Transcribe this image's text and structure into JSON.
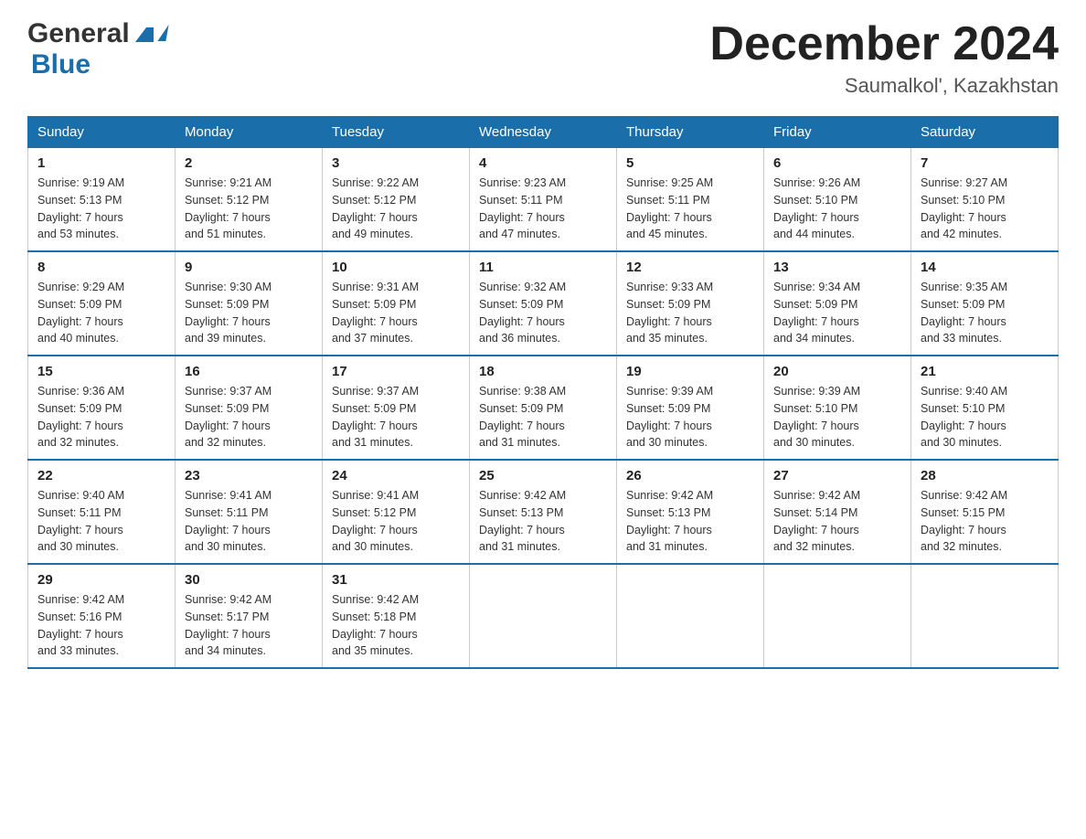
{
  "header": {
    "logo": {
      "text_general": "General",
      "text_blue": "Blue"
    },
    "title": "December 2024",
    "location": "Saumalkol', Kazakhstan"
  },
  "days_of_week": [
    "Sunday",
    "Monday",
    "Tuesday",
    "Wednesday",
    "Thursday",
    "Friday",
    "Saturday"
  ],
  "weeks": [
    [
      {
        "day": "1",
        "sunrise": "9:19 AM",
        "sunset": "5:13 PM",
        "daylight": "7 hours and 53 minutes."
      },
      {
        "day": "2",
        "sunrise": "9:21 AM",
        "sunset": "5:12 PM",
        "daylight": "7 hours and 51 minutes."
      },
      {
        "day": "3",
        "sunrise": "9:22 AM",
        "sunset": "5:12 PM",
        "daylight": "7 hours and 49 minutes."
      },
      {
        "day": "4",
        "sunrise": "9:23 AM",
        "sunset": "5:11 PM",
        "daylight": "7 hours and 47 minutes."
      },
      {
        "day": "5",
        "sunrise": "9:25 AM",
        "sunset": "5:11 PM",
        "daylight": "7 hours and 45 minutes."
      },
      {
        "day": "6",
        "sunrise": "9:26 AM",
        "sunset": "5:10 PM",
        "daylight": "7 hours and 44 minutes."
      },
      {
        "day": "7",
        "sunrise": "9:27 AM",
        "sunset": "5:10 PM",
        "daylight": "7 hours and 42 minutes."
      }
    ],
    [
      {
        "day": "8",
        "sunrise": "9:29 AM",
        "sunset": "5:09 PM",
        "daylight": "7 hours and 40 minutes."
      },
      {
        "day": "9",
        "sunrise": "9:30 AM",
        "sunset": "5:09 PM",
        "daylight": "7 hours and 39 minutes."
      },
      {
        "day": "10",
        "sunrise": "9:31 AM",
        "sunset": "5:09 PM",
        "daylight": "7 hours and 37 minutes."
      },
      {
        "day": "11",
        "sunrise": "9:32 AM",
        "sunset": "5:09 PM",
        "daylight": "7 hours and 36 minutes."
      },
      {
        "day": "12",
        "sunrise": "9:33 AM",
        "sunset": "5:09 PM",
        "daylight": "7 hours and 35 minutes."
      },
      {
        "day": "13",
        "sunrise": "9:34 AM",
        "sunset": "5:09 PM",
        "daylight": "7 hours and 34 minutes."
      },
      {
        "day": "14",
        "sunrise": "9:35 AM",
        "sunset": "5:09 PM",
        "daylight": "7 hours and 33 minutes."
      }
    ],
    [
      {
        "day": "15",
        "sunrise": "9:36 AM",
        "sunset": "5:09 PM",
        "daylight": "7 hours and 32 minutes."
      },
      {
        "day": "16",
        "sunrise": "9:37 AM",
        "sunset": "5:09 PM",
        "daylight": "7 hours and 32 minutes."
      },
      {
        "day": "17",
        "sunrise": "9:37 AM",
        "sunset": "5:09 PM",
        "daylight": "7 hours and 31 minutes."
      },
      {
        "day": "18",
        "sunrise": "9:38 AM",
        "sunset": "5:09 PM",
        "daylight": "7 hours and 31 minutes."
      },
      {
        "day": "19",
        "sunrise": "9:39 AM",
        "sunset": "5:09 PM",
        "daylight": "7 hours and 30 minutes."
      },
      {
        "day": "20",
        "sunrise": "9:39 AM",
        "sunset": "5:10 PM",
        "daylight": "7 hours and 30 minutes."
      },
      {
        "day": "21",
        "sunrise": "9:40 AM",
        "sunset": "5:10 PM",
        "daylight": "7 hours and 30 minutes."
      }
    ],
    [
      {
        "day": "22",
        "sunrise": "9:40 AM",
        "sunset": "5:11 PM",
        "daylight": "7 hours and 30 minutes."
      },
      {
        "day": "23",
        "sunrise": "9:41 AM",
        "sunset": "5:11 PM",
        "daylight": "7 hours and 30 minutes."
      },
      {
        "day": "24",
        "sunrise": "9:41 AM",
        "sunset": "5:12 PM",
        "daylight": "7 hours and 30 minutes."
      },
      {
        "day": "25",
        "sunrise": "9:42 AM",
        "sunset": "5:13 PM",
        "daylight": "7 hours and 31 minutes."
      },
      {
        "day": "26",
        "sunrise": "9:42 AM",
        "sunset": "5:13 PM",
        "daylight": "7 hours and 31 minutes."
      },
      {
        "day": "27",
        "sunrise": "9:42 AM",
        "sunset": "5:14 PM",
        "daylight": "7 hours and 32 minutes."
      },
      {
        "day": "28",
        "sunrise": "9:42 AM",
        "sunset": "5:15 PM",
        "daylight": "7 hours and 32 minutes."
      }
    ],
    [
      {
        "day": "29",
        "sunrise": "9:42 AM",
        "sunset": "5:16 PM",
        "daylight": "7 hours and 33 minutes."
      },
      {
        "day": "30",
        "sunrise": "9:42 AM",
        "sunset": "5:17 PM",
        "daylight": "7 hours and 34 minutes."
      },
      {
        "day": "31",
        "sunrise": "9:42 AM",
        "sunset": "5:18 PM",
        "daylight": "7 hours and 35 minutes."
      },
      null,
      null,
      null,
      null
    ]
  ]
}
